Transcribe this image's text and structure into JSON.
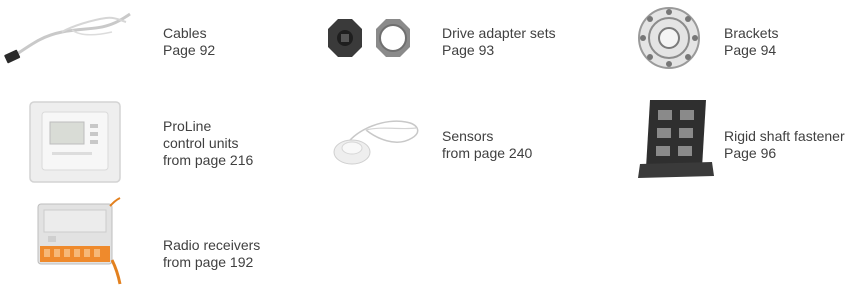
{
  "items": [
    {
      "id": "cables",
      "lines": [
        "Cables",
        "Page 92"
      ],
      "icon": "cable-icon"
    },
    {
      "id": "drive-adapter-sets",
      "lines": [
        "Drive adapter sets",
        "Page 93"
      ],
      "icon": "drive-adapter-icon"
    },
    {
      "id": "brackets",
      "lines": [
        "Brackets",
        "Page 94"
      ],
      "icon": "bracket-icon"
    },
    {
      "id": "proline-control-units",
      "lines": [
        "ProLine",
        "control units",
        "from page 216"
      ],
      "icon": "control-unit-icon"
    },
    {
      "id": "sensors",
      "lines": [
        "Sensors",
        "from page 240"
      ],
      "icon": "sensor-icon"
    },
    {
      "id": "rigid-shaft-fastener",
      "lines": [
        "Rigid shaft fastener",
        "Page 96"
      ],
      "icon": "shaft-fastener-icon"
    },
    {
      "id": "radio-receivers",
      "lines": [
        "Radio receivers",
        "from page 192"
      ],
      "icon": "radio-receiver-icon"
    }
  ]
}
